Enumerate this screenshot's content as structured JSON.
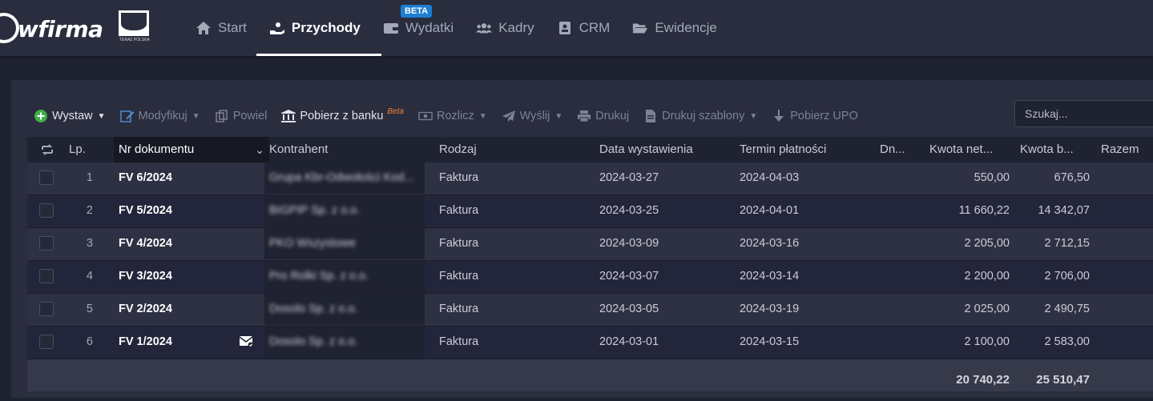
{
  "brand": {
    "logo_text": "wfirma",
    "partner_text": "TERAZ POLSKA"
  },
  "nav": {
    "items": [
      {
        "label": "Start",
        "icon": "home-icon"
      },
      {
        "label": "Przychody",
        "icon": "hand-coin-icon",
        "active": true
      },
      {
        "label": "Wydatki",
        "icon": "wallet-icon"
      },
      {
        "label": "Kadry",
        "icon": "users-icon"
      },
      {
        "label": "CRM",
        "icon": "contact-card-icon"
      },
      {
        "label": "Ewidencje",
        "icon": "folder-open-icon"
      }
    ],
    "crm_badge": "BETA"
  },
  "toolbar": {
    "wystaw": "Wystaw",
    "modyfikuj": "Modyfikuj",
    "powiel": "Powiel",
    "pobierz_z_banku": "Pobierz z banku",
    "pobierz_beta": "Beta",
    "rozlicz": "Rozlicz",
    "wyslij": "Wyślij",
    "drukuj": "Drukuj",
    "drukuj_szablony": "Drukuj szablony",
    "pobierz_upo": "Pobierz UPO"
  },
  "search": {
    "placeholder": "Szukaj..."
  },
  "table": {
    "headers": {
      "lp": "Lp.",
      "nr": "Nr dokumentu",
      "kontrahent": "Kontrahent",
      "rodzaj": "Rodzaj",
      "data": "Data wystawienia",
      "termin": "Termin płatności",
      "dn": "Dn...",
      "netto": "Kwota net...",
      "brutto": "Kwota b...",
      "razem": "Razem"
    },
    "rows": [
      {
        "lp": "1",
        "nr": "FV 6/2024",
        "kontrahent": "Grupa Kbr-Odwołości Kod...",
        "rodzaj": "Faktura",
        "data": "2024-03-27",
        "termin": "2024-04-03",
        "netto": "550,00",
        "brutto": "676,50"
      },
      {
        "lp": "2",
        "nr": "FV 5/2024",
        "kontrahent": "BIGPIP Sp. z o.o.",
        "rodzaj": "Faktura",
        "data": "2024-03-25",
        "termin": "2024-04-01",
        "netto": "11 660,22",
        "brutto": "14 342,07"
      },
      {
        "lp": "3",
        "nr": "FV 4/2024",
        "kontrahent": "PKO Wszystowe",
        "rodzaj": "Faktura",
        "data": "2024-03-09",
        "termin": "2024-03-16",
        "netto": "2 205,00",
        "brutto": "2 712,15"
      },
      {
        "lp": "4",
        "nr": "FV 3/2024",
        "kontrahent": "Pro Rolki Sp. z o.o.",
        "rodzaj": "Faktura",
        "data": "2024-03-07",
        "termin": "2024-03-14",
        "netto": "2 200,00",
        "brutto": "2 706,00"
      },
      {
        "lp": "5",
        "nr": "FV 2/2024",
        "kontrahent": "Dosolo Sp. z o.o.",
        "rodzaj": "Faktura",
        "data": "2024-03-05",
        "termin": "2024-03-19",
        "netto": "2 025,00",
        "brutto": "2 490,75"
      },
      {
        "lp": "6",
        "nr": "FV 1/2024",
        "kontrahent": "Dosolo Sp. z o.o.",
        "rodzaj": "Faktura",
        "data": "2024-03-01",
        "termin": "2024-03-15",
        "netto": "2 100,00",
        "brutto": "2 583,00"
      }
    ],
    "totals": {
      "netto": "20 740,22",
      "brutto": "25 510,47"
    }
  },
  "colors": {
    "background": "#1f2230",
    "panel": "#2a2d3e",
    "badge": "#1d7fd1",
    "accent_green": "#3fae49",
    "beta_orange": "#f0813a"
  }
}
